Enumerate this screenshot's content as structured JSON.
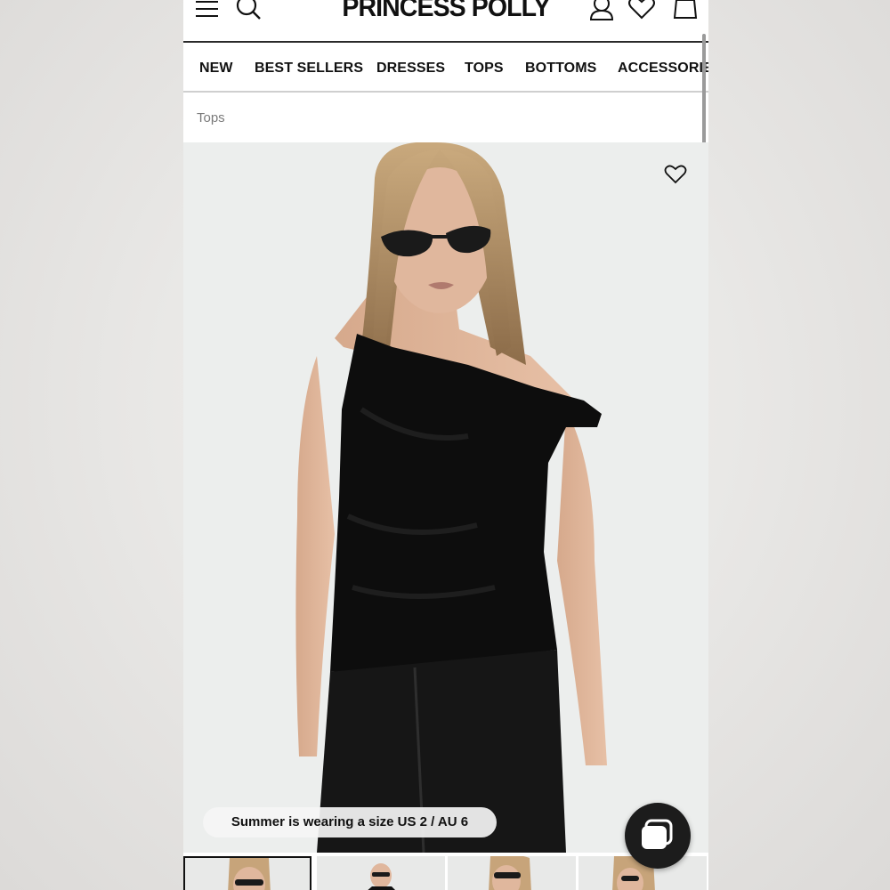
{
  "header": {
    "logo": "PRINCESS POLLY",
    "icons": [
      "menu-icon",
      "search-icon",
      "account-icon",
      "heart-icon",
      "bag-icon"
    ]
  },
  "nav": {
    "items": [
      "NEW",
      "BEST SELLERS",
      "DRESSES",
      "TOPS",
      "BOTTOMS",
      "ACCESSORIES"
    ]
  },
  "breadcrumb": "Tops",
  "product": {
    "size_note": "Summer is wearing a size US 2 / AU 6",
    "image_count_visible": 4
  },
  "chat": {
    "icon": "chat-bubble-icon"
  },
  "colors": {
    "text": "#111111",
    "breadcrumb": "#7a7a7a",
    "image_bg": "#eceeed",
    "chat_bg": "#1c1c1c"
  }
}
